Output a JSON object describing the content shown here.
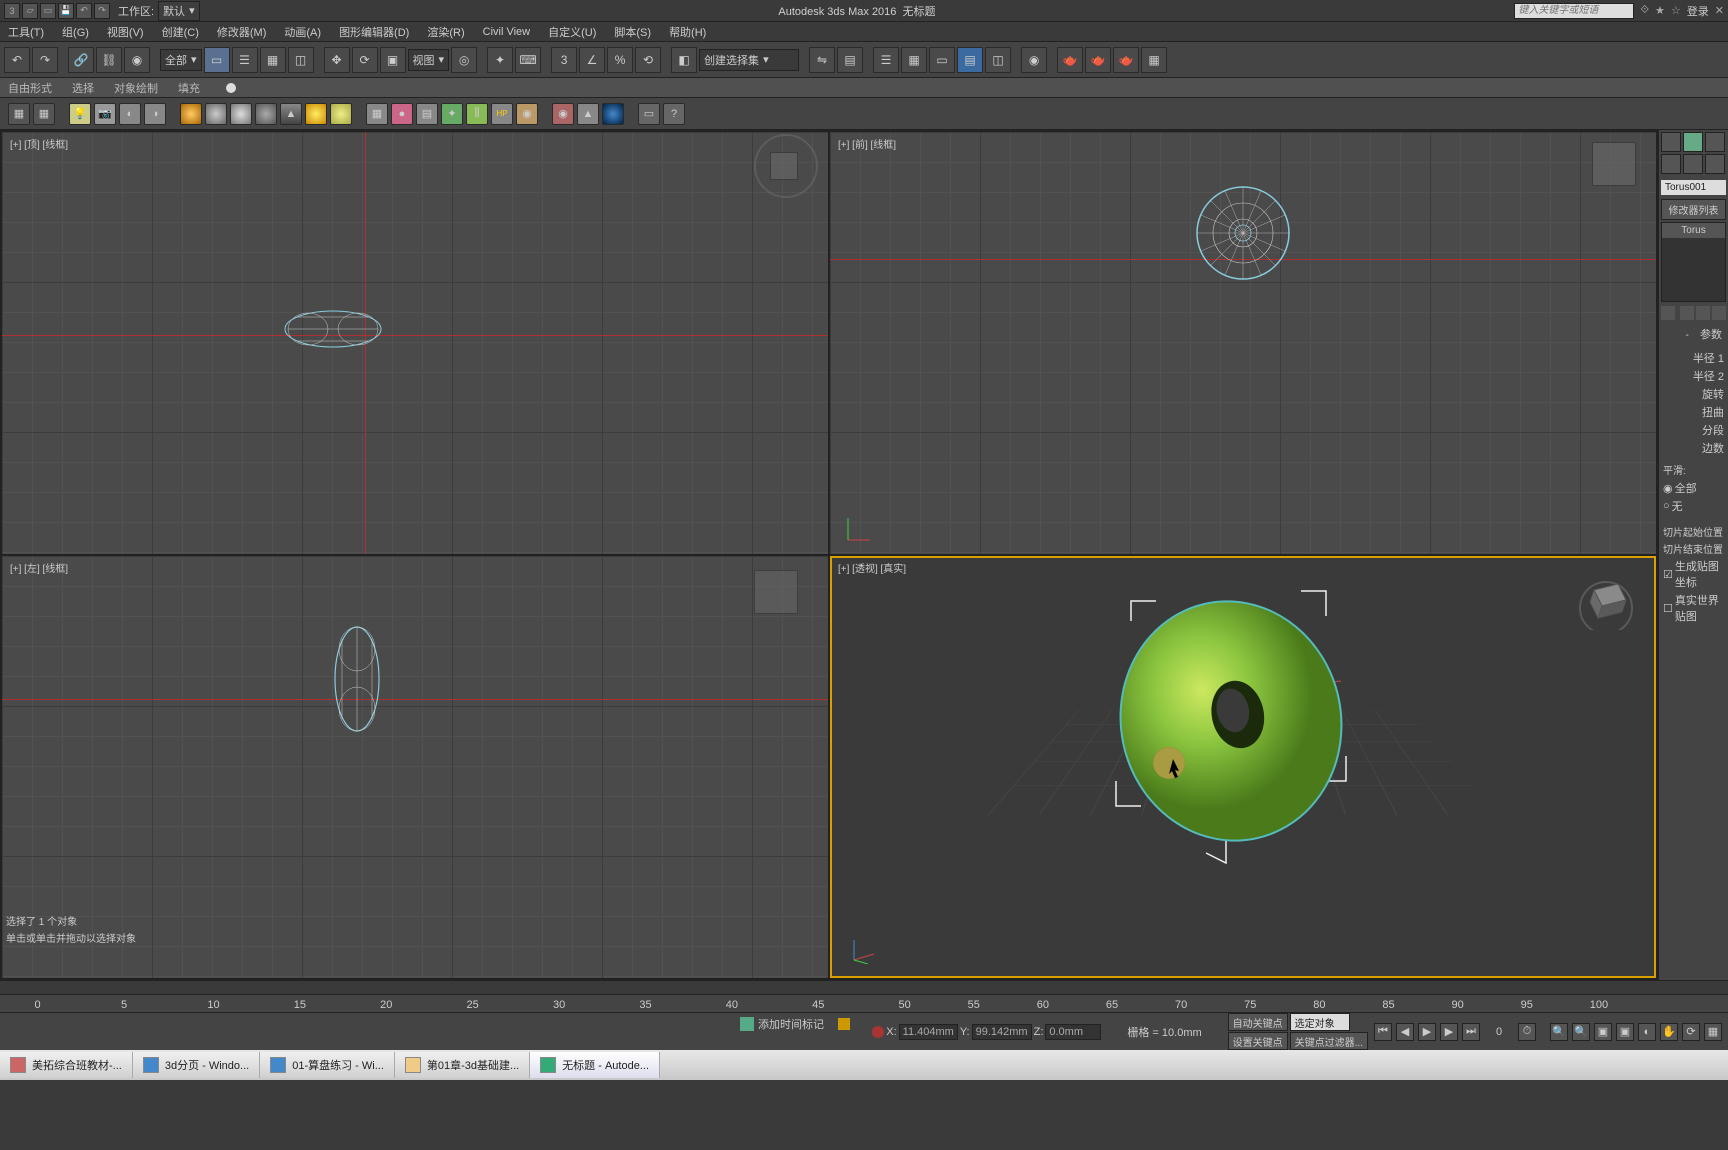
{
  "title": {
    "app": "Autodesk 3ds Max 2016",
    "doc": "无标题"
  },
  "workspace": {
    "label": "工作区:",
    "value": "默认"
  },
  "search": {
    "placeholder": "键入关键字或短语"
  },
  "login": "登录",
  "menu": [
    "工具(T)",
    "组(G)",
    "视图(V)",
    "创建(C)",
    "修改器(M)",
    "动画(A)",
    "图形编辑器(D)",
    "渲染(R)",
    "Civil View",
    "自定义(U)",
    "脚本(S)",
    "帮助(H)"
  ],
  "maintb": {
    "sel_all": "全部",
    "sel_view": "视图",
    "sel_set": "创建选择集"
  },
  "ribbon": [
    "自由形式",
    "选择",
    "对象绘制",
    "填充"
  ],
  "viewports": {
    "top": "[+] [顶] [线框]",
    "front": "[+] [前] [线框]",
    "left": "[+] [左] [线框]",
    "persp": "[+] [透视] [真实]"
  },
  "cmd": {
    "obj_name": "Torus001",
    "mod_list_hdr": "修改器列表",
    "stack_item": "Torus",
    "rollout_params": "参数",
    "params": [
      "半径 1",
      "半径 2",
      "旋转",
      "扭曲",
      "分段",
      "边数"
    ],
    "smooth_hdr": "平滑:",
    "smooth_opts": {
      "all": "全部",
      "none": "无"
    },
    "slice_start": "切片起始位置",
    "slice_end": "切片结束位置",
    "gen_map": "生成贴图坐标",
    "real_world": "真实世界贴图"
  },
  "timeline": {
    "ticks": [
      0,
      5,
      10,
      15,
      20,
      25,
      30,
      35,
      40,
      45,
      50,
      55,
      60,
      65,
      70,
      75,
      80,
      85,
      90,
      95,
      100
    ]
  },
  "status": {
    "selected": "选择了 1 个对象",
    "hint": "单击或单击并拖动以选择对象",
    "x_label": "X:",
    "x_val": "11.404mm",
    "y_label": "Y:",
    "y_val": "99.142mm",
    "z_label": "Z:",
    "z_val": "0.0mm",
    "grid": "栅格 = 10.0mm",
    "autokey": "自动关键点",
    "selobj": "选定对象",
    "setkey": "设置关键点",
    "keyfilter": "关键点过滤器...",
    "addmarker": "添加时间标记"
  },
  "taskbar": {
    "items": [
      "美拓综合班教材-...",
      "3d分页 - Windo...",
      "01-算盘练习 - Wi...",
      "第01章-3d基础建...",
      "无标题 - Autode..."
    ]
  }
}
